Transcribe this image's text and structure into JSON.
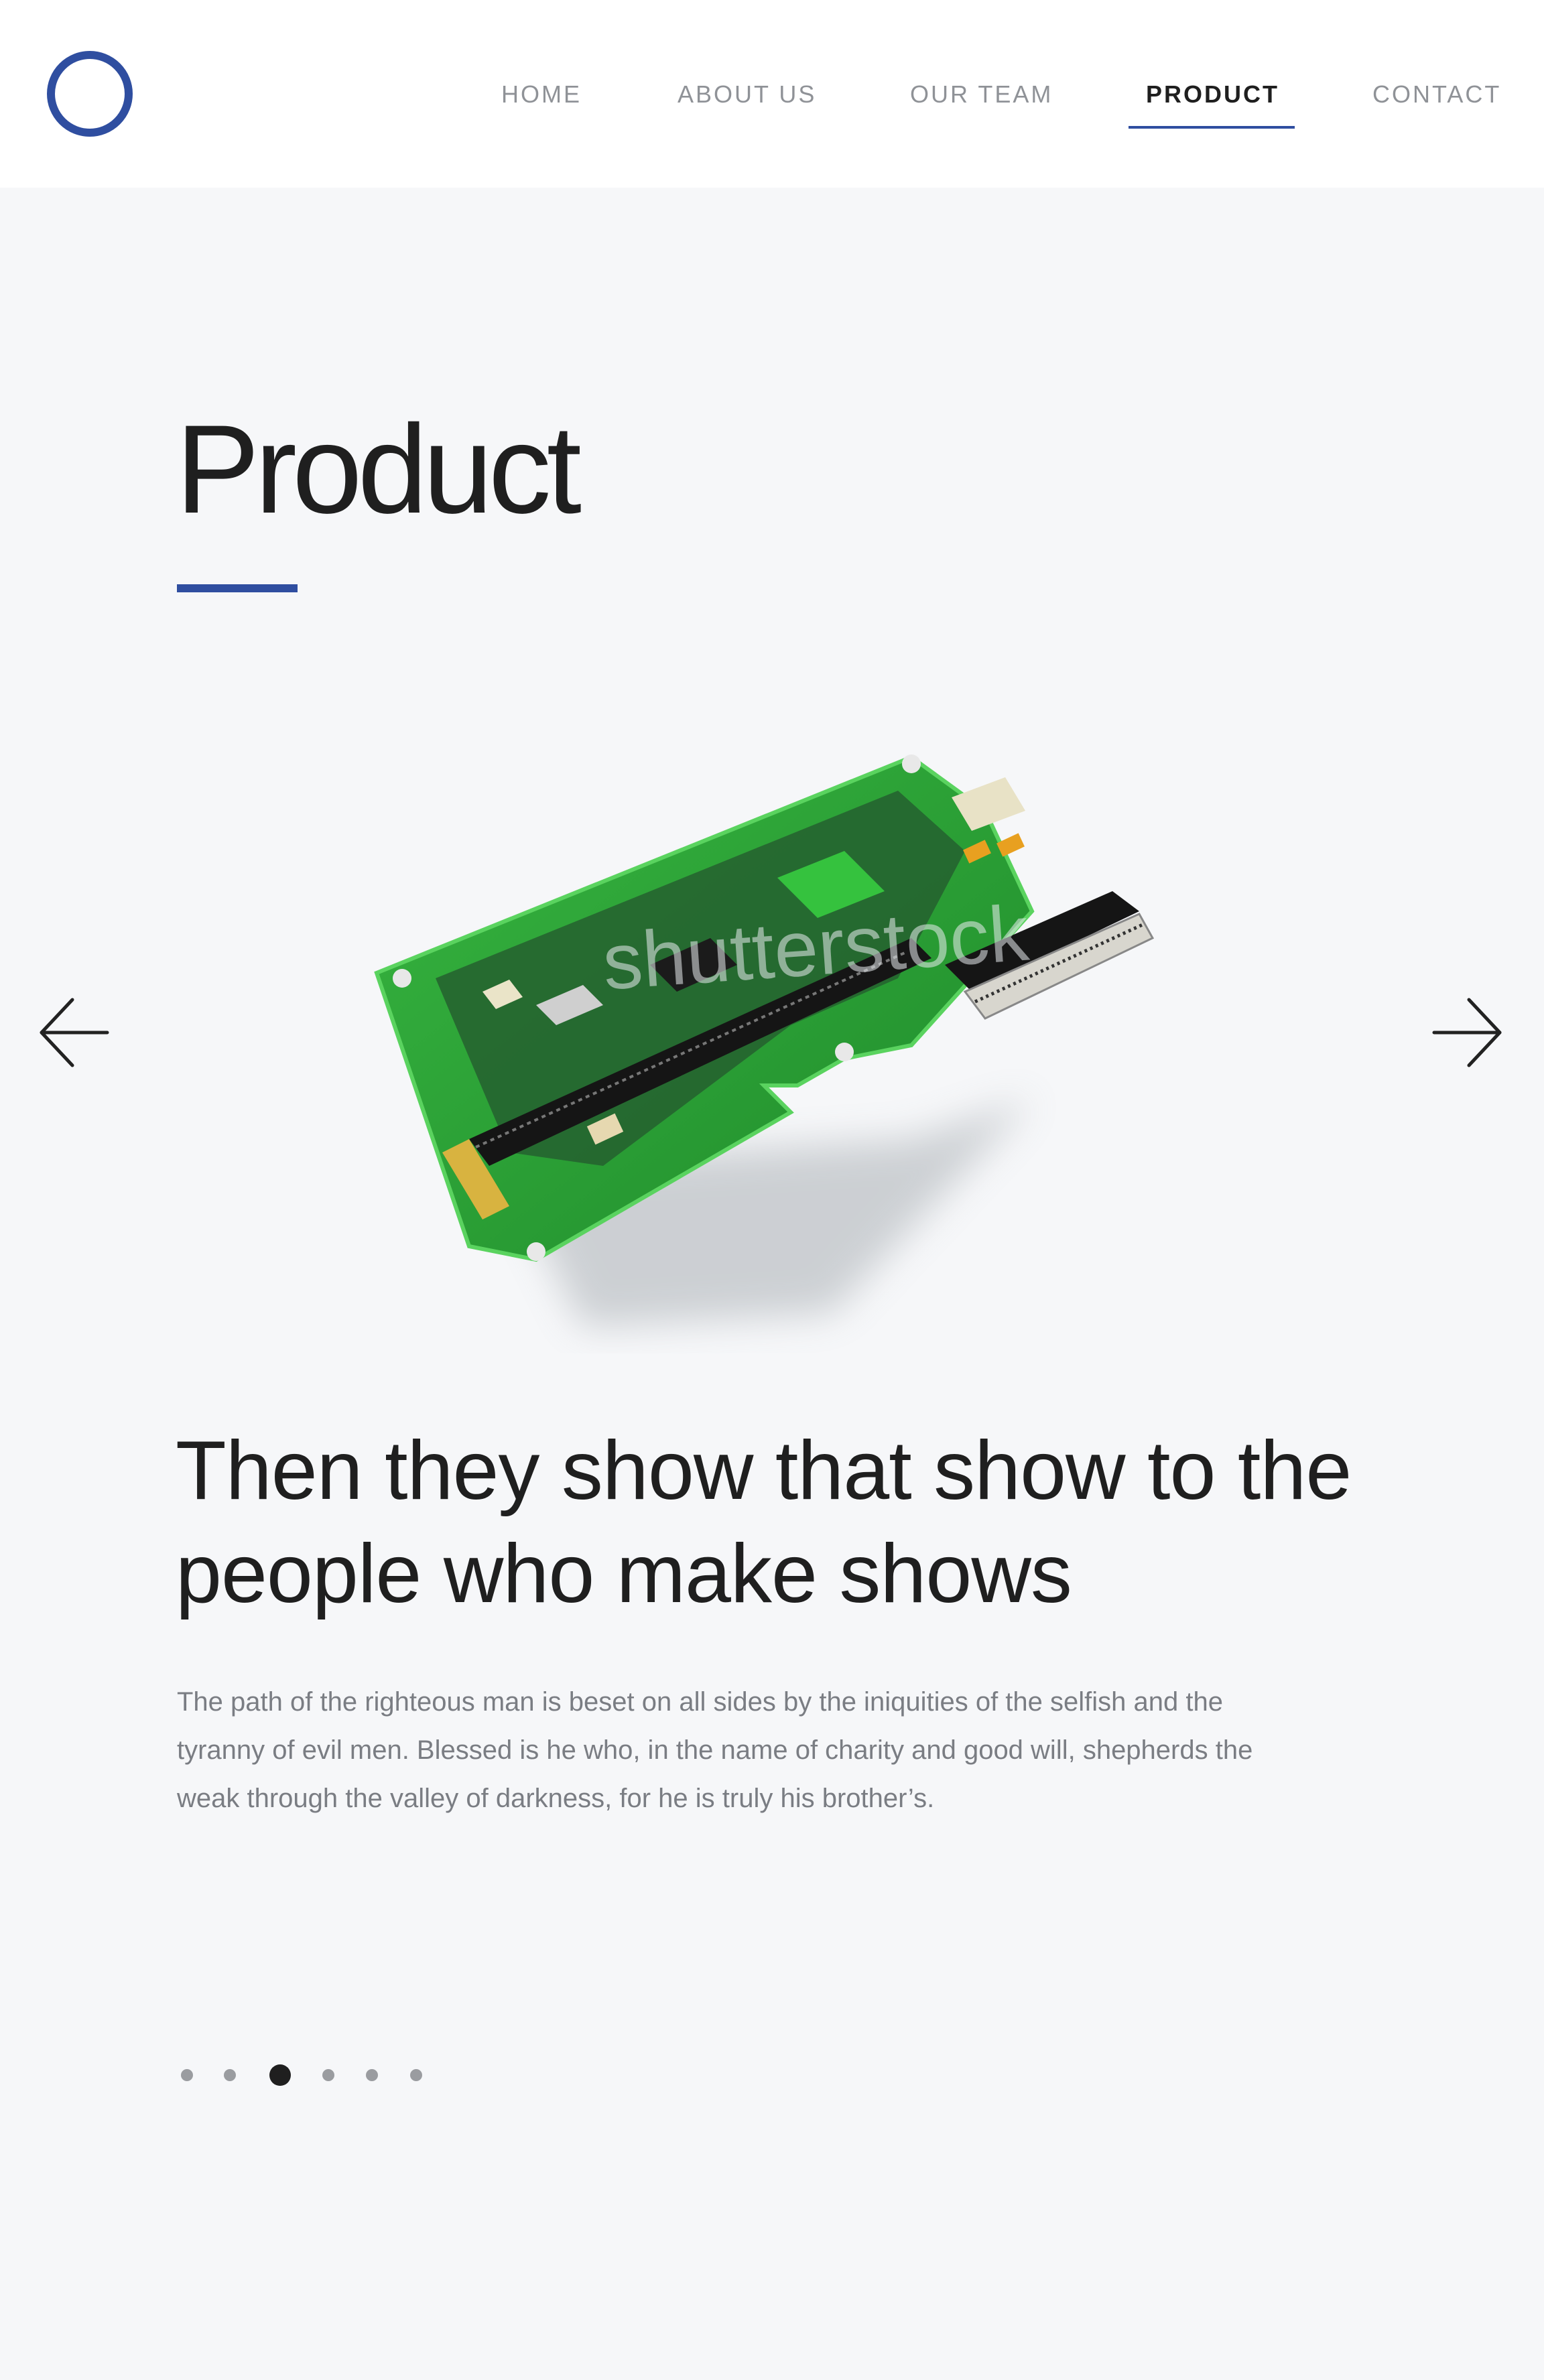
{
  "header": {
    "logo": "ring-logo",
    "nav": [
      {
        "label": "HOME"
      },
      {
        "label": "ABOUT US"
      },
      {
        "label": "OUR TEAM"
      },
      {
        "label": "PRODUCT",
        "active": true
      },
      {
        "label": "CONTACT"
      }
    ]
  },
  "section": {
    "title": "Product"
  },
  "carousel": {
    "prev_icon": "arrow-left-icon",
    "next_icon": "arrow-right-icon",
    "image": "circuit-board-photo",
    "watermark": "shutterstock",
    "heading": "Then they show that show to the people who make shows",
    "body": "The path of the righteous man is beset on all sides by the iniquities of the selfish and the tyranny of evil men. Blessed is he who, in the name of charity and good will, shepherds the weak through the valley of darkness, for he is truly his brother’s.",
    "slide_count": 6,
    "active_slide": 3
  },
  "colors": {
    "accent": "#2f4ea0",
    "background": "#f6f7f9",
    "header_bg": "#ffffff",
    "text": "#1f1f1f",
    "muted_text": "#7a7d83",
    "board_green": "#2fa83a"
  }
}
